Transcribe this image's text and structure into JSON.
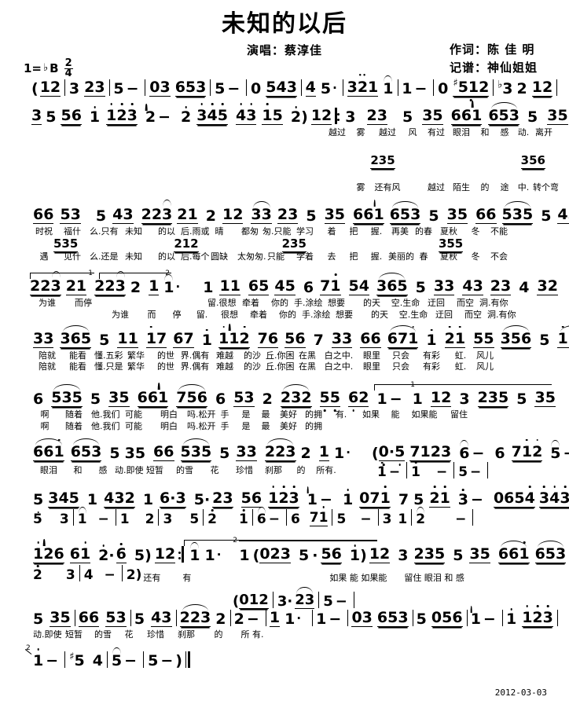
{
  "header": {
    "title": "未知的以后",
    "singer": "演唱：蔡淳佳",
    "lyricist": "作词：陈 佳 明",
    "transcriber": "记谱：神仙姐姐",
    "key_prefix": "1=",
    "key_accidental": "♭",
    "key_letter": "B",
    "meter_num": "2",
    "meter_den": "4"
  },
  "footer": {
    "date": "2012-03-03"
  },
  "score": {
    "notation_type": "jianpu",
    "systems": [
      {
        "id": "system-1",
        "notes": "(12 | 3 23 | 5 − | 03 653 | 5 − | 0 543 | 4 5· | 321 1 | 1 − | 0 ♯512 | ♭3 2 12 |",
        "lyrics_1": "",
        "lyrics_2": ""
      },
      {
        "id": "system-2",
        "notes": "3 5 56 | 1̇ 1̇2̇3̇ | 2̇ − | 2̇ 3̇4̇5̇ | 4̇3̇ 1̇5 | 2̇) 12 ‖: 3 23 | 5 35 | 661̇ 653 | 5 35 |",
        "lyrics_1": "越过 雾 越过 风 有过 眼泪 和 感 动. 离开",
        "lyrics_2": "雾 还有风 越过 陌生 的 途 中. 转个弯",
        "alt_notes": "235 / 356"
      },
      {
        "id": "system-3",
        "notes": "66 53 | 5 43 | 223 21 | 2 12 | 33 23 | 5 35 | 661̇ 653 | 5 35 | 66 535 | 5 43 |",
        "lyrics_1": "时祝 福什 么. 只有 未知 的以 后. 雨或 晴 都匆 匆. 只能 学习 着 把 握. 再美 的春 夏秋 冬 不能",
        "lyrics_2": "遇 见什 么. 还是 未知 的以 后. 每个 圆缺 太匆匆. 只能 学着 去 把 握. 美丽的 春 夏秋 冬 不会",
        "alt_notes": "535 / 212 / 235 / 355"
      },
      {
        "id": "system-4",
        "notes": "223 21 | 223 2 | 1 1· | 1 11 | 65 45 | 6 71̇ | 54 365 | 5 33 | 43 23 | 4 32 |",
        "lyrics_1": "为谁 而停 留. 很想 牵着 你的 手. 涂绘 想要 的天 空. 生命 迂回 而空 洞. 有你",
        "lyrics_2": "为谁 而 停 留. 很想 牵着 你的 手. 涂绘 想要 的天 空. 生命 迂回 而空 洞. 有你",
        "volta1": "1",
        "volta2": "2"
      },
      {
        "id": "system-5",
        "notes": "33 365 | 5 11 | 1̇7 67 | 1̇ 1̇1̇2̇ | 76 56 | 7 33 | 66 671̇ | 1̇ 2̇1̇ | 55 356 | 5 1̇76 |",
        "lyrics_1": "陪就 能看 懂. 五彩 繁华 的世 界. 偶有 难越 的沙 丘. 你困 在黑 白之中. 眼里 只会 有彩 虹. 风儿",
        "lyrics_2": "陪就 能看 懂. 只是 繁华 的世 界. 偶有 难越 的沙 丘. 你困 在黑 白之中. 眼里 只会 有彩 虹. 风儿"
      },
      {
        "id": "system-6",
        "notes": "6 535 | 5 35 | 661̇ 756 | 6 53 | 2 232 | 55 62 | 1 − | 1 12 | 3 235 | 5 35 |",
        "lyrics_1": "啊 随着 他. 我们 可能 明白 吗. 松开 手 是 最 美好 的拥 有. 如果 能 如果能 留住",
        "lyrics_2": "啊 随着 他. 我们 可能 明白 吗. 松开 手 是 最 美好 的拥",
        "volta1": "1"
      },
      {
        "id": "system-7",
        "notes": "661̇ 653 | 5 35 | 66 535 | 5 33 | 223 2 | 1 1· | (0·5 7123 | 6 − | 6 71̇2̇ | 5 −",
        "notes_lower": "1̇ − | 1̇ − | 5 −",
        "lyrics_1": "眼泪 和 感 动. 即使 短暂 的雪 花 珍惜 刹那 的 所有."
      },
      {
        "id": "system-8",
        "notes": "5 345 | 1 432 | 1 6·3 | 5·23 | 56 1̇2̇3̇ | 1̇ − | 1̇ 071̇ | 7 5 2̇1̇ | 3̇ − | 0654̇ 3̇4̇3̇6",
        "notes_lower": "5 3 | 1 − | 1 2 | 3 5 | 2̇ 1̇ | 6 − | 6 71̇ | 5 − | 3 1 | 2 −",
        "lyrics_1": ""
      },
      {
        "id": "system-9",
        "notes": "1̇2̇6 61̇ | 2̇·6̇ | 5) 12 :‖ 1 1· | 1 (023 | 5 · 56 | 1̇) 12 | 3 235 | 5 35 | 661̇ 653 |",
        "notes_lower": "2̇ 3 | 4 − | 2)",
        "lyrics_1": "还有 有 如果 能 如果能 留住 眼泪 和 感",
        "volta2": "2"
      },
      {
        "id": "system-10",
        "notes": "5 35 | 66 53 | 5 43 | 223 2 | 2 − | 1 1· | 1 − | 03 653 | 5 056 | 1̇ − | 1̇ 1̇2̇3̇ |",
        "notes_upper": "(012 | 3 · 23 | 5 −",
        "lyrics_1": "动. 即使 短暂 的雪 花 珍惜 刹那 的 所 有."
      },
      {
        "id": "system-11",
        "notes": "1̇ − | ♯5 4 | 5 − | 5 −) ‖",
        "volta2": "2",
        "lyrics_1": ""
      }
    ]
  }
}
